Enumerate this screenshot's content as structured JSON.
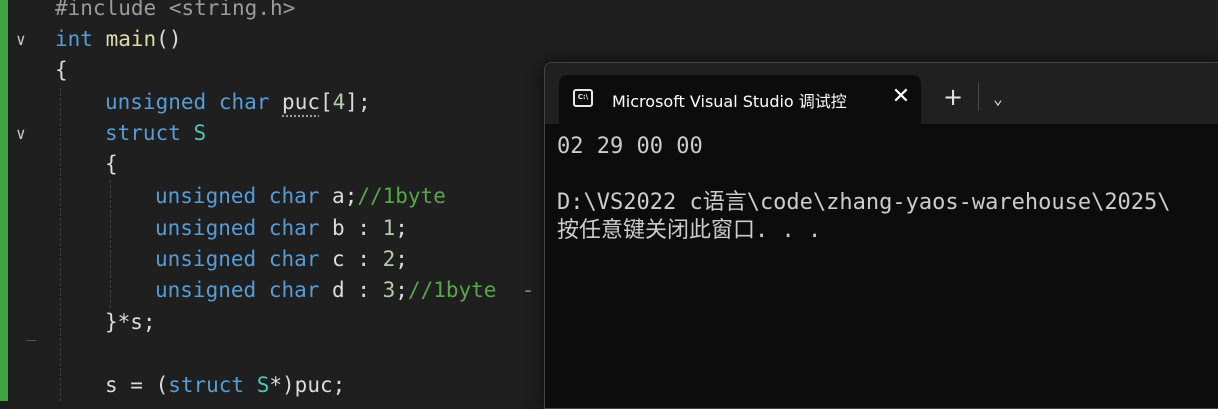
{
  "editor": {
    "lines": [
      {
        "kind": "include",
        "directive": "#include",
        "header": "<string.h>"
      },
      {
        "kind": "main",
        "type": "int",
        "name": "main",
        "parens": "()"
      },
      {
        "kind": "plain",
        "text": "{"
      },
      {
        "kind": "decl",
        "kw1": "unsigned",
        "kw2": "char",
        "var": "puc",
        "rest": "[",
        "num": "4",
        "end": "];"
      },
      {
        "kind": "struct",
        "kw": "struct",
        "name": "S"
      },
      {
        "kind": "plain",
        "text": "{"
      },
      {
        "kind": "field",
        "kw1": "unsigned",
        "kw2": "char",
        "rest": "a;",
        "comment": "//1byte"
      },
      {
        "kind": "bitfield",
        "kw1": "unsigned",
        "kw2": "char",
        "rest": "b : ",
        "num": "1",
        "end": ";"
      },
      {
        "kind": "bitfield",
        "kw1": "unsigned",
        "kw2": "char",
        "rest": "c : ",
        "num": "2",
        "end": ";"
      },
      {
        "kind": "bitfield",
        "kw1": "unsigned",
        "kw2": "char",
        "rest": "d : ",
        "num": "3",
        "end": ";",
        "comment": "//1byte  -"
      },
      {
        "kind": "plain",
        "text": "}*s;"
      },
      {
        "kind": "plain",
        "text": ""
      },
      {
        "kind": "cast",
        "pre": "s = (",
        "kw": "struct",
        "type": "S",
        "post": "*)puc;"
      }
    ]
  },
  "terminal": {
    "title": "Microsoft Visual Studio 调试控",
    "icon": "terminal-icon",
    "close_icon": "close-icon",
    "new_tab_icon": "plus-icon",
    "dropdown_icon": "chevron-down-icon",
    "output": [
      "02 29 00 00",
      "",
      "D:\\VS2022 c语言\\code\\zhang-yaos-warehouse\\2025\\",
      "按任意键关闭此窗口. . ."
    ]
  }
}
